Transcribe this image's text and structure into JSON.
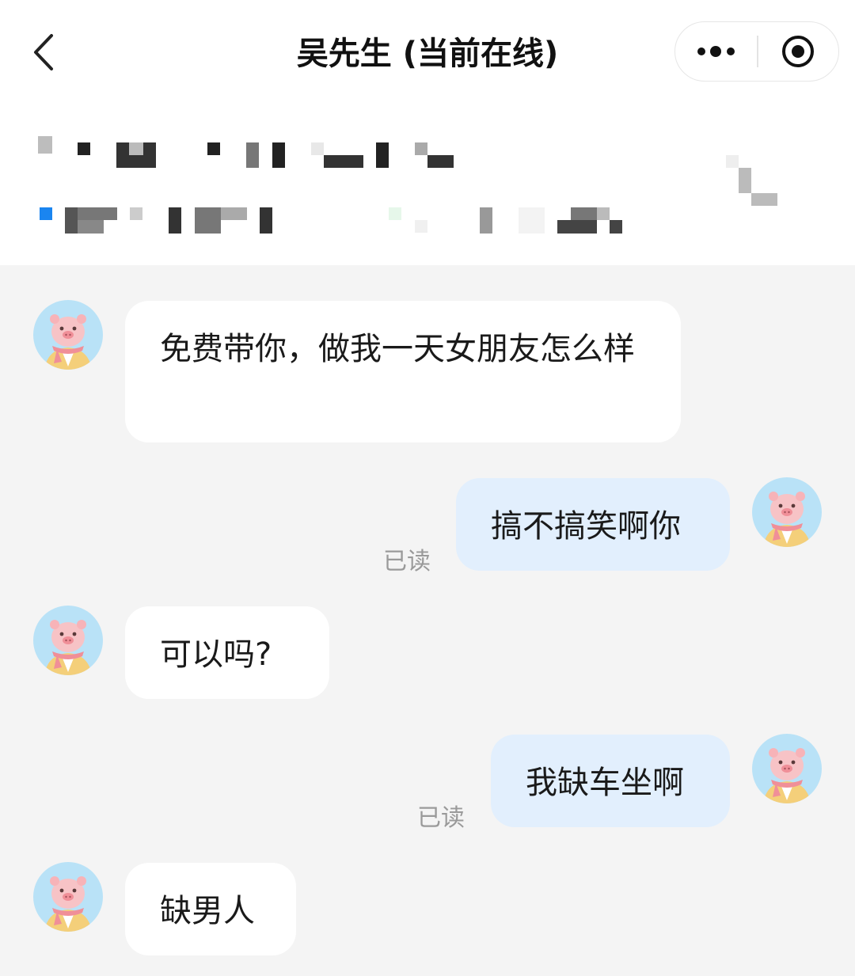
{
  "header": {
    "title": "吴先生 (当前在线)",
    "back_icon": "chevron-left-icon",
    "more_icon": "more-dots-icon",
    "close_icon": "record-circle-icon"
  },
  "messages": [
    {
      "direction": "in",
      "text": "免费带你，做我一天女朋友怎么样"
    },
    {
      "direction": "out",
      "text": "搞不搞笑啊你",
      "status": "已读"
    },
    {
      "direction": "in",
      "text": "可以吗?"
    },
    {
      "direction": "out",
      "text": "我缺车坐啊",
      "status": "已读"
    },
    {
      "direction": "in",
      "text": "缺男人"
    }
  ],
  "colors": {
    "incoming_bubble": "#ffffff",
    "outgoing_bubble": "#e2effd",
    "chat_background": "#f4f4f4",
    "avatar_background": "#b9e2f7"
  }
}
